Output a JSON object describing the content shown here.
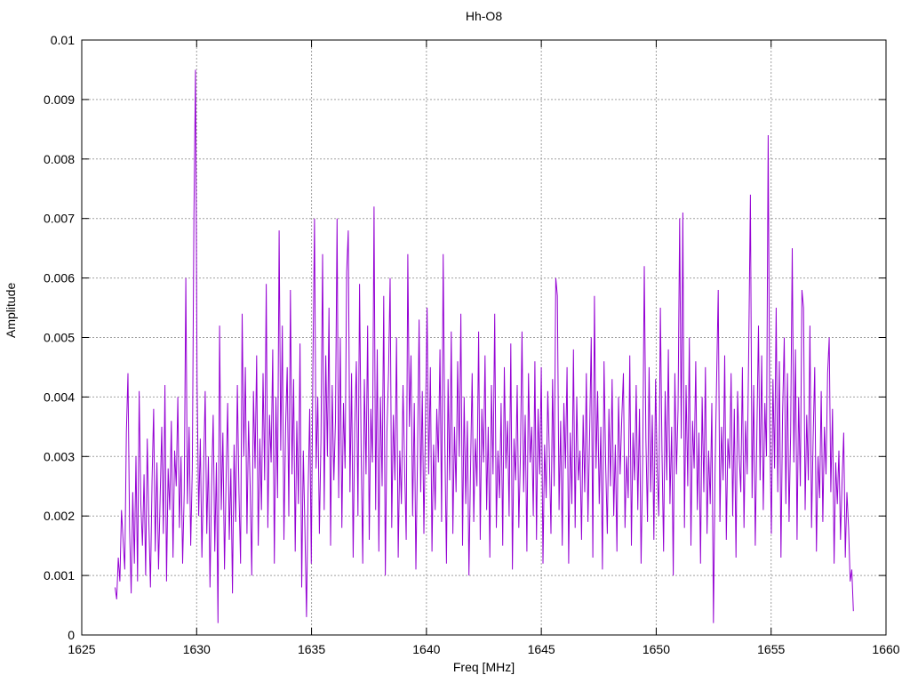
{
  "page": {
    "background": "#ffffff",
    "text_color": "#000000"
  },
  "chart_data": {
    "type": "line",
    "title": "Hh-O8",
    "xlabel": "Freq [MHz]",
    "ylabel": "Amplitude",
    "xlim": [
      1625,
      1660
    ],
    "ylim": [
      0,
      0.01
    ],
    "x_ticks": [
      1625,
      1630,
      1635,
      1640,
      1645,
      1650,
      1655,
      1660
    ],
    "x_tick_labels": [
      "1625",
      "1630",
      "1635",
      "1640",
      "1645",
      "1650",
      "1655",
      "1660"
    ],
    "y_ticks": [
      0,
      0.001,
      0.002,
      0.003,
      0.004,
      0.005,
      0.006,
      0.007,
      0.008,
      0.009,
      0.01
    ],
    "y_tick_labels": [
      "0",
      "0.001",
      "0.002",
      "0.003",
      "0.004",
      "0.005",
      "0.006",
      "0.007",
      "0.008",
      "0.009",
      "0.01"
    ],
    "grid": true,
    "grid_style": "dotted",
    "grid_color": "#a0a0a0",
    "border_color": "#000000",
    "line_color": "#9400d3",
    "data_x_range": [
      1626.45,
      1658.58
    ],
    "major_peaks": [
      {
        "x": 1629.95,
        "y": 0.0095
      },
      {
        "x": 1654.9,
        "y": 0.0084
      },
      {
        "x": 1654.1,
        "y": 0.0074
      },
      {
        "x": 1637.7,
        "y": 0.0072
      },
      {
        "x": 1651.15,
        "y": 0.0071
      },
      {
        "x": 1629.9,
        "y": 0.007
      },
      {
        "x": 1635.15,
        "y": 0.007
      },
      {
        "x": 1636.1,
        "y": 0.007
      },
      {
        "x": 1633.6,
        "y": 0.0068
      },
      {
        "x": 1636.6,
        "y": 0.0068
      },
      {
        "x": 1655.9,
        "y": 0.0065
      },
      {
        "x": 1639.2,
        "y": 0.0064
      },
      {
        "x": 1640.7,
        "y": 0.0064
      },
      {
        "x": 1649.5,
        "y": 0.0062
      },
      {
        "x": 1645.6,
        "y": 0.006
      }
    ],
    "samples": {
      "x_start": 1626.45,
      "x_step": 0.07,
      "y_scale": 0.0001,
      "values": [
        8,
        6,
        13,
        9,
        21,
        16,
        11,
        34,
        44,
        18,
        7,
        24,
        12,
        30,
        9,
        41,
        22,
        15,
        27,
        10,
        33,
        19,
        8,
        26,
        38,
        14,
        29,
        11,
        23,
        35,
        17,
        42,
        9,
        28,
        21,
        36,
        13,
        31,
        25,
        40,
        18,
        30,
        12,
        24,
        60,
        22,
        35,
        15,
        28,
        70,
        95,
        42,
        20,
        33,
        13,
        27,
        41,
        17,
        30,
        8,
        25,
        37,
        14,
        29,
        2,
        52,
        21,
        34,
        11,
        26,
        39,
        16,
        28,
        7,
        32,
        19,
        42,
        24,
        12,
        54,
        30,
        45,
        17,
        36,
        25,
        10,
        41,
        28,
        47,
        15,
        33,
        21,
        44,
        26,
        59,
        18,
        37,
        29,
        48,
        12,
        40,
        23,
        68,
        31,
        52,
        16,
        35,
        45,
        20,
        58,
        27,
        43,
        14,
        36,
        22,
        49,
        8,
        31,
        18,
        3,
        24,
        38,
        12,
        45,
        70,
        28,
        40,
        17,
        33,
        64,
        21,
        47,
        30,
        55,
        15,
        42,
        26,
        36,
        70,
        23,
        50,
        18,
        39,
        28,
        61,
        68,
        24,
        44,
        13,
        35,
        46,
        20,
        59,
        31,
        12,
        43,
        27,
        52,
        16,
        38,
        29,
        72,
        21,
        48,
        14,
        40,
        25,
        57,
        10,
        34,
        44,
        60,
        18,
        37,
        26,
        50,
        13,
        31,
        22,
        42,
        28,
        16,
        64,
        35,
        47,
        20,
        39,
        11,
        30,
        53,
        24,
        41,
        17,
        36,
        55,
        27,
        45,
        14,
        32,
        21,
        38,
        29,
        48,
        19,
        64,
        33,
        12,
        43,
        26,
        51,
        17,
        35,
        24,
        46,
        30,
        54,
        15,
        40,
        22,
        36,
        10,
        28,
        44,
        19,
        33,
        25,
        51,
        16,
        38,
        29,
        47,
        21,
        35,
        13,
        42,
        27,
        54,
        18,
        31,
        23,
        39,
        15,
        45,
        28,
        36,
        20,
        49,
        11,
        33,
        26,
        42,
        18,
        30,
        51,
        24,
        37,
        14,
        44,
        29,
        35,
        20,
        46,
        16,
        38,
        27,
        45,
        12,
        32,
        23,
        41,
        30,
        17,
        43,
        25,
        60,
        57,
        21,
        36,
        15,
        39,
        28,
        45,
        12,
        34,
        22,
        48,
        18,
        40,
        26,
        31,
        16,
        37,
        24,
        44,
        19,
        33,
        50,
        13,
        57,
        28,
        41,
        22,
        35,
        11,
        46,
        29,
        17,
        38,
        25,
        43,
        20,
        32,
        14,
        40,
        27,
        36,
        44,
        18,
        30,
        23,
        47,
        15,
        34,
        26,
        42,
        21,
        38,
        12,
        29,
        62,
        33,
        19,
        45,
        24,
        37,
        16,
        43,
        28,
        20,
        55,
        31,
        14,
        41,
        26,
        48,
        22,
        35,
        10,
        44,
        27,
        38,
        70,
        33,
        71,
        18,
        42,
        25,
        50,
        15,
        36,
        28,
        46,
        21,
        34,
        12,
        40,
        24,
        45,
        17,
        31,
        22,
        39,
        2,
        27,
        43,
        58,
        19,
        35,
        26,
        47,
        16,
        33,
        28,
        44,
        20,
        38,
        13,
        41,
        30,
        24,
        45,
        18,
        36,
        27,
        49,
        74,
        23,
        42,
        15,
        34,
        52,
        26,
        47,
        21,
        39,
        30,
        84,
        35,
        17,
        43,
        28,
        55,
        24,
        46,
        13,
        37,
        50,
        22,
        44,
        19,
        34,
        65,
        29,
        48,
        16,
        40,
        25,
        58,
        55,
        21,
        37,
        26,
        52,
        18,
        33,
        45,
        14,
        30,
        23,
        41,
        19,
        35,
        27,
        44,
        50,
        24,
        38,
        12,
        29,
        22,
        31,
        16,
        26,
        34,
        13,
        24,
        18,
        9,
        11,
        4
      ]
    }
  }
}
